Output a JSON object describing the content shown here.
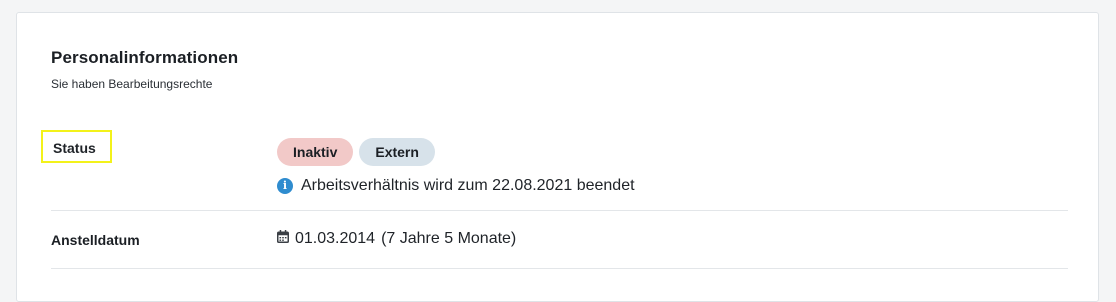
{
  "card": {
    "title": "Personalinformationen",
    "subtitle": "Sie haben Bearbeitungsrechte"
  },
  "status_row": {
    "label": "Status",
    "badges": [
      {
        "label": "Inaktiv",
        "color": "#f2c9c8"
      },
      {
        "label": "Extern",
        "color": "#d7e2ea"
      }
    ],
    "info_icon": "info-circle-icon",
    "info_text": "Arbeitsverhältnis wird zum 22.08.2021 beendet"
  },
  "date_row": {
    "label": "Anstelldatum",
    "icon": "calendar-icon",
    "value": "01.03.2014",
    "duration": "(7 Jahre 5 Monate)"
  },
  "colors": {
    "info_blue": "#2f8ccf",
    "highlight_yellow": "#f3f21a"
  }
}
